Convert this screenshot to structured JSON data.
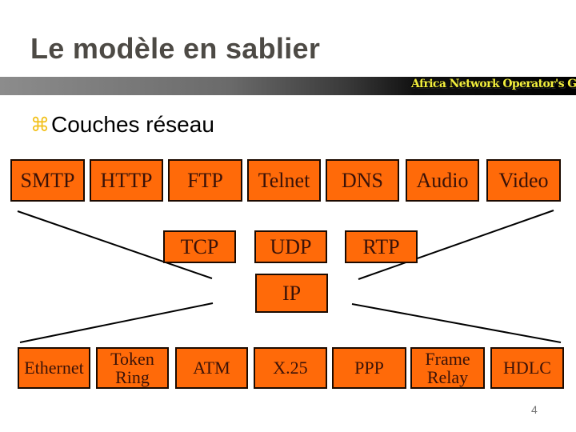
{
  "slide": {
    "title": "Le modèle en sablier",
    "logo_text": "Africa Network Operator's Group",
    "subtitle_bullet_icon": "command-key-bullet",
    "subtitle": "Couches réseau",
    "page_number": "4"
  },
  "diagram": {
    "box_color": "#ff6a09",
    "application_layer": [
      "SMTP",
      "HTTP",
      "FTP",
      "Telnet",
      "DNS",
      "Audio",
      "Video"
    ],
    "transport_layer": [
      "TCP",
      "UDP",
      "RTP"
    ],
    "network_layer": [
      "IP"
    ],
    "link_layer": [
      "Ethernet",
      "Token Ring",
      "ATM",
      "X.25",
      "PPP",
      "Frame Relay",
      "HDLC"
    ]
  }
}
